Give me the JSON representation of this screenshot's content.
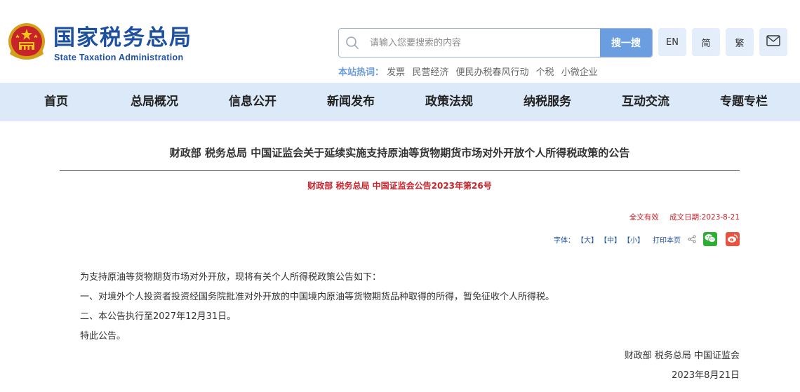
{
  "header": {
    "logo_cn": "国家税务总局",
    "logo_en": "State Taxation Administration",
    "search": {
      "placeholder": "请输入您要搜索的内容",
      "button_label": "搜一搜"
    },
    "lang_buttons": [
      "EN",
      "简",
      "繁"
    ],
    "mail_icon": "mail-icon",
    "hot_words": {
      "label": "本站热词：",
      "items": [
        "发票",
        "民营经济",
        "便民办税春风行动",
        "个税",
        "小微企业"
      ]
    }
  },
  "nav": {
    "items": [
      "首页",
      "总局概况",
      "信息公开",
      "新闻发布",
      "政策法规",
      "纳税服务",
      "互动交流",
      "专题专栏"
    ]
  },
  "article": {
    "title": "财政部 税务总局 中国证监会关于延续实施支持原油等货物期货市场对外开放个人所得税政策的公告",
    "doc_number": "财政部 税务总局 中国证监会公告2023年第26号",
    "validity": "全文有效",
    "date_label": "成文日期:",
    "date": "2023-8-21",
    "tools": {
      "font_label": "字体：",
      "font_options": [
        "【大】",
        "【中】",
        "【小】"
      ],
      "print_label": "打印本页",
      "share_icon": "share-icon",
      "wechat_icon": "wechat-icon",
      "weibo_icon": "weibo-icon"
    },
    "paragraphs": [
      "为支持原油等货物期货市场对外开放，现将有关个人所得税政策公告如下：",
      "一、对境外个人投资者投资经国务院批准对外开放的中国境内原油等货物期货品种取得的所得，暂免征收个人所得税。",
      "二、本公告执行至2027年12月31日。",
      "特此公告。"
    ],
    "signature": "财政部  税务总局  中国证监会",
    "sign_date": "2023年8月21日"
  },
  "colors": {
    "brand_blue": "#1e50a2",
    "nav_bg": "#dbe9f8",
    "search_button": "#6b9ee0",
    "accent_red": "#c8222a"
  }
}
